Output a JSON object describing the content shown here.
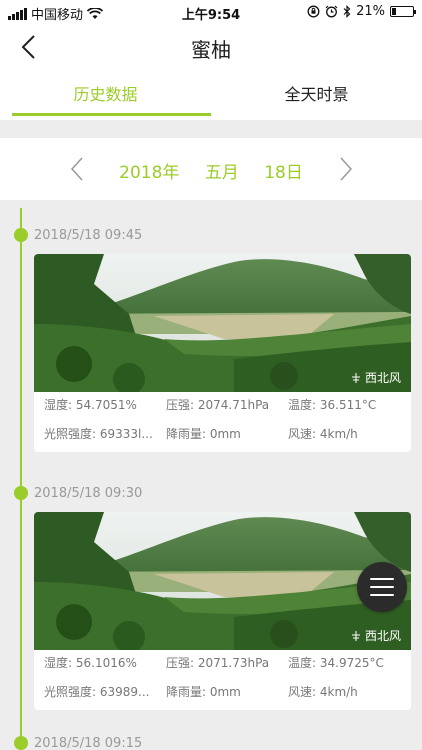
{
  "status_bar": {
    "carrier": "中国移动",
    "time": "上午9:54",
    "battery": "21%",
    "battery_level": 0.21,
    "icons": [
      "signal-icon",
      "wifi-icon",
      "lock-rotation-icon",
      "alarm-icon",
      "bluetooth-icon",
      "battery-icon"
    ]
  },
  "nav": {
    "title": "蜜柚",
    "back_icon": "chevron-left-icon"
  },
  "tabs": [
    {
      "label": "历史数据",
      "active": true
    },
    {
      "label": "全天时景",
      "active": false
    }
  ],
  "date_selector": {
    "year": "2018年",
    "month": "五月",
    "day": "18日",
    "prev_icon": "chevron-left-icon",
    "next_icon": "chevron-right-icon"
  },
  "entries": [
    {
      "time": "2018/5/18 09:45",
      "wind_direction": "西北风",
      "stats": {
        "humidity": "湿度: 54.7051%",
        "pressure": "压强: 2074.71hPa",
        "temperature": "温度: 36.511°C",
        "light": "光照强度: 69333l...",
        "rainfall": "降雨量: 0mm",
        "wind_speed": "风速: 4km/h"
      }
    },
    {
      "time": "2018/5/18 09:30",
      "wind_direction": "西北风",
      "stats": {
        "humidity": "湿度: 56.1016%",
        "pressure": "压强: 2071.73hPa",
        "temperature": "温度: 34.9725°C",
        "light": "光照强度: 63989...",
        "rainfall": "降雨量: 0mm",
        "wind_speed": "风速: 4km/h"
      }
    },
    {
      "time": "2018/5/18 09:15"
    }
  ],
  "fab": {
    "icon": "menu-icon"
  },
  "colors": {
    "accent": "#9acd2a",
    "background": "#ededed",
    "card": "#ffffff",
    "fab": "#2b2b2b"
  }
}
